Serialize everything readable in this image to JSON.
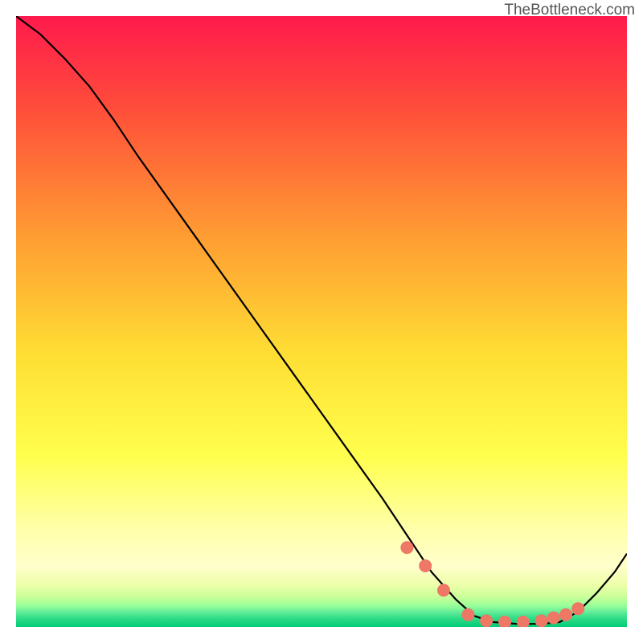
{
  "watermark": "TheBottleneck.com",
  "chart_data": {
    "type": "line",
    "title": "",
    "xlabel": "",
    "ylabel": "",
    "xlim": [
      0,
      100
    ],
    "ylim": [
      0,
      100
    ],
    "gradient_stops": [
      {
        "offset": 0,
        "color": "#ff1a4d"
      },
      {
        "offset": 0.15,
        "color": "#ff4d3a"
      },
      {
        "offset": 0.35,
        "color": "#ff9933"
      },
      {
        "offset": 0.55,
        "color": "#ffdd33"
      },
      {
        "offset": 0.72,
        "color": "#ffff4d"
      },
      {
        "offset": 0.84,
        "color": "#ffffaa"
      },
      {
        "offset": 0.9,
        "color": "#ffffcc"
      },
      {
        "offset": 0.93,
        "color": "#eeffaa"
      },
      {
        "offset": 0.95,
        "color": "#ccff99"
      },
      {
        "offset": 0.965,
        "color": "#99ff99"
      },
      {
        "offset": 0.975,
        "color": "#66ee99"
      },
      {
        "offset": 0.985,
        "color": "#33dd88"
      },
      {
        "offset": 1.0,
        "color": "#00cc77"
      }
    ],
    "curve": {
      "x": [
        0,
        4,
        8,
        12,
        16,
        20,
        25,
        30,
        35,
        40,
        45,
        50,
        55,
        60,
        64,
        68,
        72,
        75,
        78,
        82,
        86,
        89,
        92,
        95,
        98,
        100
      ],
      "y": [
        100,
        97,
        93,
        88.5,
        83,
        77,
        70,
        63,
        56,
        49,
        42,
        35,
        28,
        21,
        15,
        9,
        4.5,
        1.8,
        0.8,
        0.5,
        0.5,
        0.8,
        2.5,
        5.5,
        9,
        12
      ]
    },
    "dots": {
      "x": [
        64,
        67,
        70,
        74,
        77,
        80,
        83,
        86,
        88,
        90,
        92
      ],
      "y": [
        13,
        10,
        6,
        2,
        1,
        0.8,
        0.8,
        1,
        1.5,
        2,
        3
      ],
      "color": "#ee7766",
      "radius": 8
    }
  }
}
